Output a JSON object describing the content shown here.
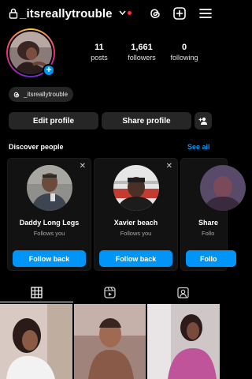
{
  "header": {
    "username": "_itsreallytrouble",
    "icons": [
      "lock-icon",
      "chevron-down-icon",
      "threads-icon",
      "create-icon",
      "menu-icon"
    ],
    "notification_color": "#ff3040"
  },
  "profile": {
    "stats": [
      {
        "value": "11",
        "label": "posts"
      },
      {
        "value": "1,661",
        "label": "followers"
      },
      {
        "value": "0",
        "label": "following"
      }
    ],
    "threads_handle": "_itsreallytrouble"
  },
  "actions": {
    "edit_profile": "Edit profile",
    "share_profile": "Share profile"
  },
  "discover": {
    "title": "Discover people",
    "see_all": "See all",
    "cards": [
      {
        "name": "Daddy Long Legs",
        "subtitle": "Follows you",
        "button": "Follow back"
      },
      {
        "name": "Xavier beach",
        "subtitle": "Follows you",
        "button": "Follow back"
      },
      {
        "name": "Share",
        "subtitle": "Follo",
        "button": "Follo"
      }
    ]
  },
  "tabs": [
    "grid-icon",
    "reels-icon",
    "tagged-icon"
  ],
  "colors": {
    "accent": "#0095f6",
    "button_bg": "#262626",
    "background": "#000000"
  }
}
